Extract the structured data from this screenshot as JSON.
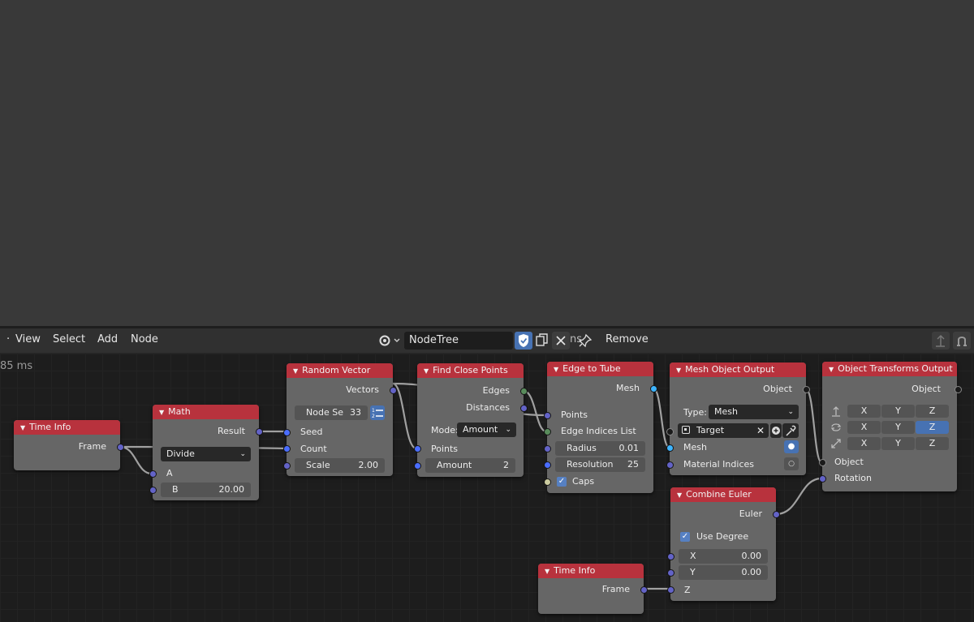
{
  "header": {
    "menus": [
      "View",
      "Select",
      "Add",
      "Node"
    ],
    "node_tree_name": "NodeTree",
    "hidden_label_fragment": "ns",
    "remove_label": "Remove"
  },
  "editor": {
    "timing_text": "85 ms"
  },
  "nodes": {
    "time_info_1": {
      "title": "Time Info",
      "frame": "Frame"
    },
    "math": {
      "title": "Math",
      "result": "Result",
      "operation": "Divide",
      "a": "A",
      "b_label": "B",
      "b_value": "20.00"
    },
    "random_vector": {
      "title": "Random Vector",
      "vectors": "Vectors",
      "node_seed_label": "Node Se",
      "node_seed_value": "33",
      "seed": "Seed",
      "count": "Count",
      "scale_label": "Scale",
      "scale_value": "2.00"
    },
    "find_close_points": {
      "title": "Find Close Points",
      "edges": "Edges",
      "distances": "Distances",
      "mode_label": "Mode:",
      "mode_value": "Amount",
      "points": "Points",
      "amount_label": "Amount",
      "amount_value": "2"
    },
    "edge_to_tube": {
      "title": "Edge to Tube",
      "mesh": "Mesh",
      "points": "Points",
      "edge_indices": "Edge Indices List",
      "radius_label": "Radius",
      "radius_value": "0.01",
      "resolution_label": "Resolution",
      "resolution_value": "25",
      "caps": "Caps"
    },
    "mesh_object_output": {
      "title": "Mesh Object Output",
      "object": "Object",
      "type_label": "Type:",
      "type_value": "Mesh",
      "target": "Target",
      "mesh": "Mesh",
      "material_indices": "Material Indices"
    },
    "object_transforms_output": {
      "title": "Object Transforms Output",
      "object_out": "Object",
      "x": "X",
      "y": "Y",
      "z": "Z",
      "object_in": "Object",
      "rotation": "Rotation"
    },
    "combine_euler": {
      "title": "Combine Euler",
      "euler": "Euler",
      "use_degree": "Use Degree",
      "x_label": "X",
      "x_value": "0.00",
      "y_label": "Y",
      "y_value": "0.00",
      "z": "Z"
    },
    "time_info_2": {
      "title": "Time Info",
      "frame": "Frame"
    }
  },
  "colors": {
    "node_header": "#b8323d",
    "node_body": "#666666",
    "accent_blue": "#4772b3",
    "editor_bg": "#1d1d1d"
  }
}
